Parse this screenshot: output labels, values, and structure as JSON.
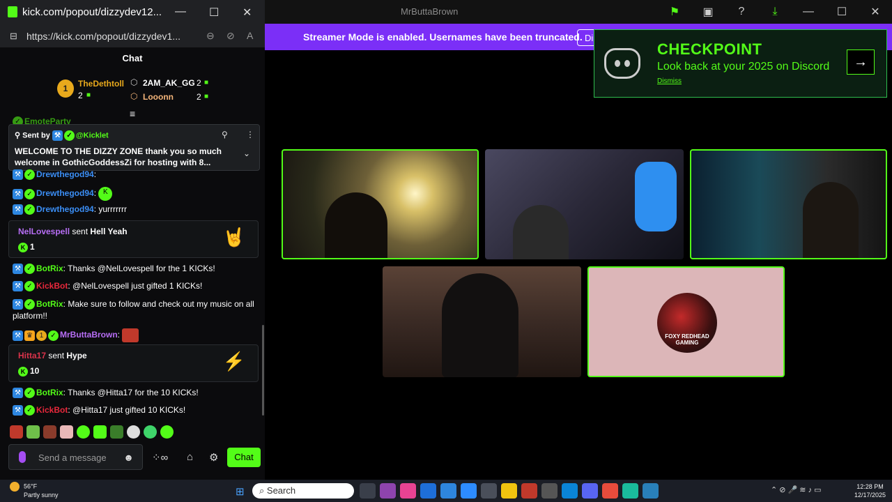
{
  "popout": {
    "title": "kick.com/popout/dizzydev12...",
    "url": "https://kick.com/popout/dizzydev1...",
    "chat_header": "Chat"
  },
  "leaderboard": {
    "rank_badge": "1",
    "top_user": "TheDethtoll",
    "top_count": "2",
    "users": [
      {
        "name": "2AM_AK_GG",
        "count": "2"
      },
      {
        "name": "Looonn",
        "count": "2"
      }
    ]
  },
  "pinned": {
    "sent_by_label": "Sent by",
    "sender": "@Kicklet",
    "message": "WELCOME TO THE DIZZY ZONE thank you so much welcome in GothicGoddessZi for hosting with 8..."
  },
  "messages": [
    {
      "user": "EmoteParty",
      "text": ""
    },
    {
      "user": "Drewthegod94",
      "text": ":"
    },
    {
      "user": "Drewthegod94",
      "text": ":"
    },
    {
      "user": "Drewthegod94",
      "text": ": yurrrrrrr"
    }
  ],
  "gift1": {
    "user": "NelLovespell",
    "sent": "sent",
    "item": "Hell Yeah",
    "amount": "1"
  },
  "messages2": [
    {
      "user": "BotRix",
      "text": ": Thanks @NelLovespell for the 1 KICKs!"
    },
    {
      "user": "KickBot",
      "text": ": @NelLovespell just gifted 1 KICKs!"
    },
    {
      "user": "BotRix",
      "text": ": Make sure to follow and check out my music on all"
    },
    {
      "user": "",
      "text": "platform!!"
    },
    {
      "user": "MrButtaBrown",
      "text": ":"
    }
  ],
  "gift2": {
    "user": "Hitta17",
    "sent": "sent",
    "item": "Hype",
    "amount": "10"
  },
  "messages3": [
    {
      "user": "BotRix",
      "text": ": Thanks @Hitta17 for the 10 KICKs!"
    },
    {
      "user": "KickBot",
      "text": ": @Hitta17 just gifted 10 KICKs!"
    }
  ],
  "composer": {
    "placeholder": "Send a message",
    "chat_button": "Chat"
  },
  "main": {
    "top_title": "MrButtaBrown",
    "overlay_number": "10",
    "banner_text": "Streamer Mode is enabled. Usernames have been truncated.",
    "banner_button": "Di",
    "discord_title": "CHECKPOINT",
    "discord_sub": "Look back at your 2025 on Discord",
    "discord_dismiss": "Dismiss",
    "tile5_logo": "FOXY REDHEAD GAMING"
  },
  "taskbar": {
    "temp": "56°F",
    "weather": "Partly sunny",
    "search": "Search",
    "time": "12:28 PM",
    "date": "12/17/2025"
  },
  "colors": {
    "kick_green": "#53fc18",
    "banner_purple": "#7b2ff7",
    "mod_blue": "#2d86e0"
  }
}
